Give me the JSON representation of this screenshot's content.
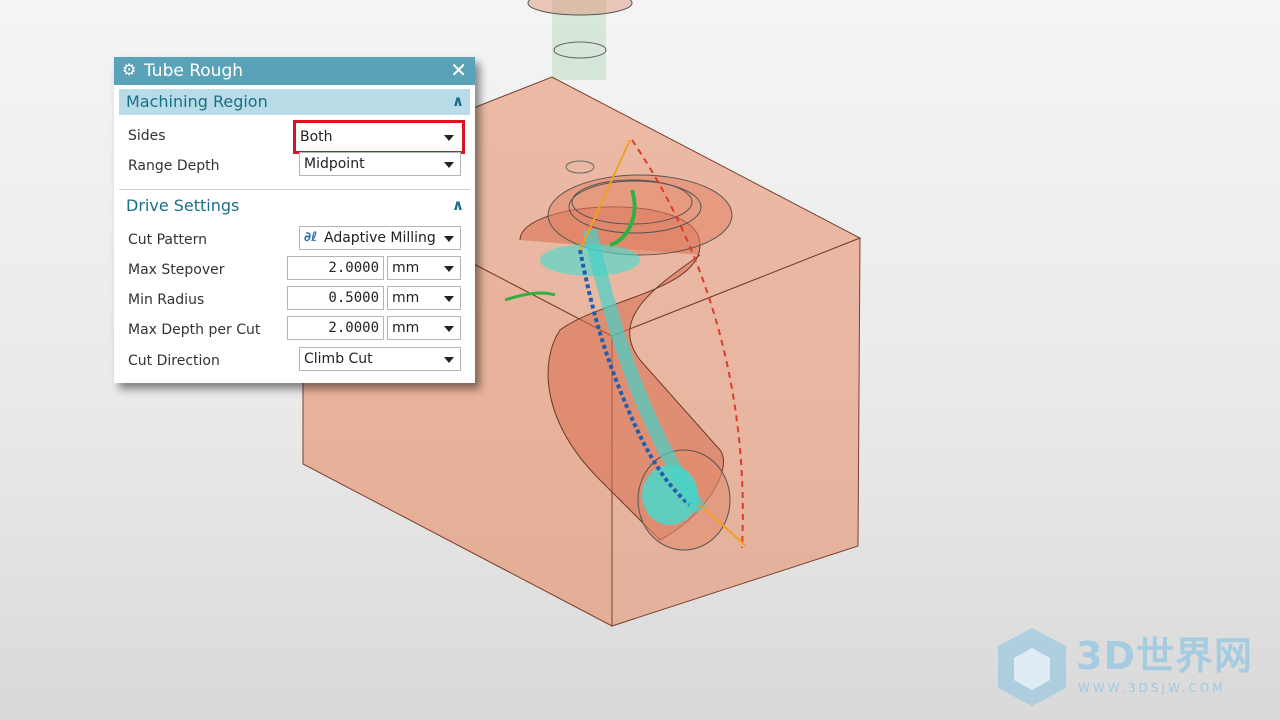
{
  "dialog": {
    "title": "Tube Rough",
    "icon": "gear-icon",
    "close_icon": "close-icon"
  },
  "machining_region": {
    "label": "Machining Region",
    "sides": {
      "label": "Sides",
      "value": "Both"
    },
    "range_depth": {
      "label": "Range Depth",
      "value": "Midpoint"
    }
  },
  "drive_settings": {
    "label": "Drive Settings",
    "cut_pattern": {
      "label": "Cut Pattern",
      "value": "Adaptive Milling"
    },
    "max_stepover": {
      "label": "Max Stepover",
      "value": "2.0000",
      "unit": "mm"
    },
    "min_radius": {
      "label": "Min Radius",
      "value": "0.5000",
      "unit": "mm"
    },
    "max_depth_per_cut": {
      "label": "Max Depth per Cut",
      "value": "2.0000",
      "unit": "mm"
    },
    "cut_direction": {
      "label": "Cut Direction",
      "value": "Climb Cut"
    }
  },
  "watermark": {
    "text": "3D世界网",
    "url": "WWW.3DSJW.COM"
  },
  "colors": {
    "title_bar": "#5aa2b8",
    "group_header": "#b9dde8",
    "highlight": "#d8141e",
    "stock": "#e8906a"
  }
}
